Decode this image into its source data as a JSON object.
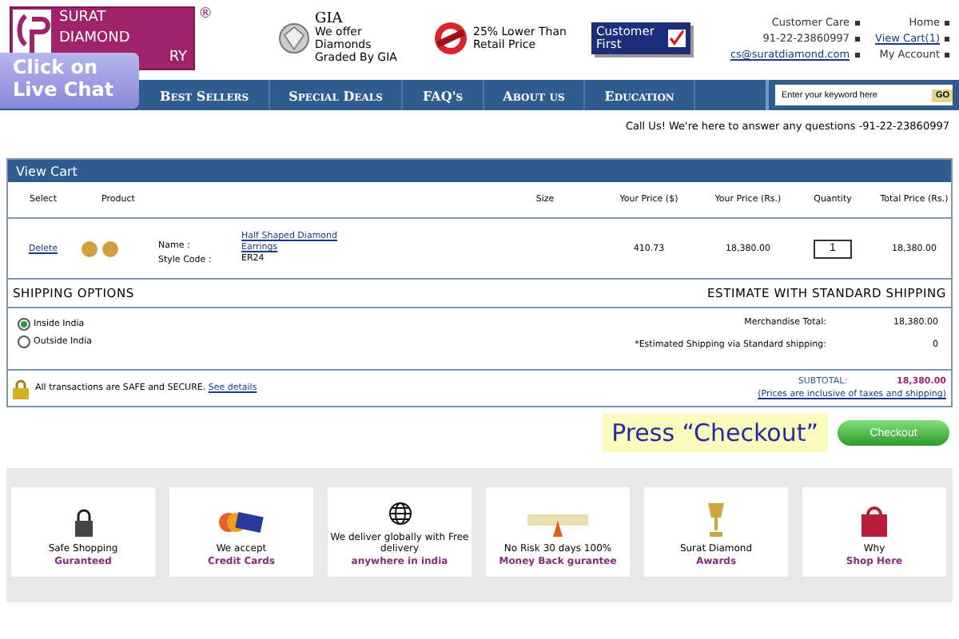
{
  "logo": {
    "lines": [
      "SURAT",
      "DIAMOND",
      "RY"
    ],
    "mark": "®"
  },
  "live_chat": "Click on Live Chat",
  "badges": [
    {
      "kind": "gia",
      "title": "GIA",
      "text": "We offer Diamonds Graded By GIA"
    },
    {
      "kind": "lower",
      "text": "25% Lower Than Retail Price"
    },
    {
      "kind": "first",
      "title": "Customer First"
    }
  ],
  "top_links": [
    {
      "label": "Customer Care",
      "link": false
    },
    {
      "label": "Home",
      "link": false
    },
    {
      "label": "91-22-23860997",
      "link": false
    },
    {
      "label": "View Cart(1)",
      "link": true
    },
    {
      "label": "cs@suratdiamond.com",
      "link": true
    },
    {
      "label": "My Account",
      "link": false
    }
  ],
  "nav": [
    "Best Sellers",
    "Special Deals",
    "FAQ's",
    "About us",
    "Education"
  ],
  "search": {
    "placeholder": "Enter your keyword here",
    "button": "GO"
  },
  "call_line": "Call Us! We're here to answer any questions -91-22-23860997",
  "cart": {
    "title": "View Cart",
    "columns": [
      "Select",
      "Product",
      "",
      "Size",
      "Your Price ($)",
      "Your Price (Rs.)",
      "Quantity",
      "Total Price (Rs.)"
    ],
    "rows": [
      {
        "action": "Delete",
        "name_label": "Name :",
        "name": "Half Shaped Diamond Earrings",
        "style_label": "Style Code :",
        "style": "ER24",
        "size": "",
        "price_usd": "410.73",
        "price_rs": "18,380.00",
        "quantity": "1",
        "total": "18,380.00"
      }
    ]
  },
  "shipping": {
    "title": "SHIPPING OPTIONS",
    "estimate_title": "ESTIMATE WITH STANDARD SHIPPING",
    "options": [
      {
        "label": "Inside India",
        "selected": true
      },
      {
        "label": "Outside India",
        "selected": false
      }
    ],
    "totals": [
      {
        "label": "Merchandise Total:",
        "value": "18,380.00"
      },
      {
        "label": "*Estimated Shipping via Standard shipping:",
        "value": "0"
      }
    ]
  },
  "secure": {
    "text": "All transactions are SAFE and SECURE.",
    "link": "See details"
  },
  "subtotal": {
    "label": "SUBTOTAL:",
    "value": "18,380.00",
    "note": "(Prices are inclusive of taxes and shipping)"
  },
  "hint": "Press “Checkout”",
  "checkout": "Checkout",
  "features": [
    {
      "kind": "lock",
      "line1": "Safe Shopping",
      "line2": "Guranteed"
    },
    {
      "kind": "card",
      "line1": "We accept",
      "line2": "Credit Cards"
    },
    {
      "kind": "globe",
      "line1": "We deliver globally with Free delivery",
      "line2": "anywhere in india"
    },
    {
      "kind": "guarantee",
      "line1": "No Risk 30 days 100%",
      "line2": "Money Back gurantee"
    },
    {
      "kind": "trophy",
      "line1": "Surat Diamond",
      "line2": "Awards"
    },
    {
      "kind": "bag",
      "line1": "Why",
      "line2": "Shop Here"
    }
  ]
}
